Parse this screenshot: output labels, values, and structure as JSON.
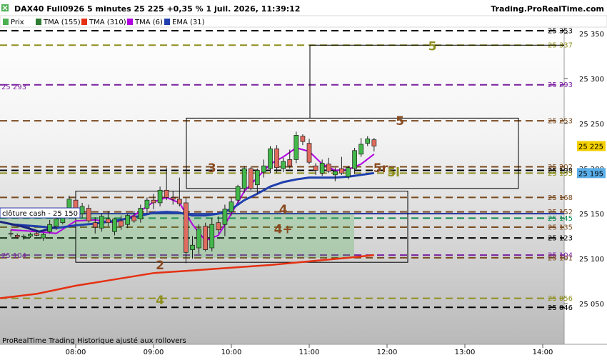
{
  "header": {
    "title": "DAX40 Full0926 5 minutes 25 225 +0,35 % 1 juil. 2026, 11:39:12",
    "site": "Trading.ProRealTime.com"
  },
  "legend": [
    {
      "label": "Prix",
      "color": "#4caf50"
    },
    {
      "label": "TMA (155)",
      "color": "#2e7d32"
    },
    {
      "label": "TMA (310)",
      "color": "#e53012"
    },
    {
      "label": "TMA (6)",
      "color": "#b000e0"
    },
    {
      "label": "EMA (31)",
      "color": "#1f3fae"
    }
  ],
  "footer": {
    "text": "ProRealTime Trading  Historique ajusté aux rollovers"
  },
  "annotations": {
    "cloture_label": "clôture cash - ",
    "cloture_value": "25 150",
    "left_price": "25 104",
    "left_price_purple": "25 293"
  },
  "chart_data": {
    "type": "candlestick",
    "instrument": "DAX40 Full0926",
    "timeframe": "5 minutes",
    "x_ticks": [
      "08:00",
      "09:00",
      "10:00",
      "11:00",
      "12:00",
      "13:00",
      "14:00"
    ],
    "y_ticks": [
      25050,
      25100,
      25150,
      25200,
      25250,
      25300,
      25350
    ],
    "y_tick_labels": [
      "25 050",
      "25 100",
      "25 150",
      "25 200",
      "25 250",
      "25 300",
      "25 350"
    ],
    "ylim": [
      25007,
      25360
    ],
    "current_price": "25 225",
    "ema_last": "25 195",
    "candles": [
      {
        "t": "07:10",
        "o": 25128,
        "h": 25132,
        "l": 25124,
        "c": 25128
      },
      {
        "t": "07:15",
        "o": 25126,
        "h": 25128,
        "l": 25122,
        "c": 25124
      },
      {
        "t": "07:20",
        "o": 25124,
        "h": 25127,
        "l": 25121,
        "c": 25125
      },
      {
        "t": "07:25",
        "o": 25125,
        "h": 25129,
        "l": 25123,
        "c": 25127
      },
      {
        "t": "07:30",
        "o": 25128,
        "h": 25130,
        "l": 25125,
        "c": 25126
      },
      {
        "t": "07:35",
        "o": 25123,
        "h": 25129,
        "l": 25120,
        "c": 25127
      },
      {
        "t": "07:40",
        "o": 25130,
        "h": 25143,
        "l": 25128,
        "c": 25138
      },
      {
        "t": "07:45",
        "o": 25136,
        "h": 25147,
        "l": 25132,
        "c": 25144
      },
      {
        "t": "07:50",
        "o": 25140,
        "h": 25153,
        "l": 25138,
        "c": 25150
      },
      {
        "t": "07:55",
        "o": 25150,
        "h": 25170,
        "l": 25147,
        "c": 25166
      },
      {
        "t": "08:00",
        "o": 25165,
        "h": 25168,
        "l": 25147,
        "c": 25150
      },
      {
        "t": "08:05",
        "o": 25150,
        "h": 25162,
        "l": 25145,
        "c": 25158
      },
      {
        "t": "08:10",
        "o": 25156,
        "h": 25160,
        "l": 25140,
        "c": 25142
      },
      {
        "t": "08:15",
        "o": 25140,
        "h": 25146,
        "l": 25128,
        "c": 25135
      },
      {
        "t": "08:20",
        "o": 25134,
        "h": 25150,
        "l": 25130,
        "c": 25147
      },
      {
        "t": "08:25",
        "o": 25144,
        "h": 25153,
        "l": 25136,
        "c": 25140
      },
      {
        "t": "08:30",
        "o": 25130,
        "h": 25145,
        "l": 25126,
        "c": 25144
      },
      {
        "t": "08:35",
        "o": 25142,
        "h": 25148,
        "l": 25132,
        "c": 25136
      },
      {
        "t": "08:40",
        "o": 25138,
        "h": 25150,
        "l": 25134,
        "c": 25148
      },
      {
        "t": "08:45",
        "o": 25147,
        "h": 25153,
        "l": 25140,
        "c": 25142
      },
      {
        "t": "08:50",
        "o": 25144,
        "h": 25160,
        "l": 25140,
        "c": 25156
      },
      {
        "t": "08:55",
        "o": 25156,
        "h": 25168,
        "l": 25150,
        "c": 25165
      },
      {
        "t": "09:00",
        "o": 25165,
        "h": 25172,
        "l": 25155,
        "c": 25162
      },
      {
        "t": "09:05",
        "o": 25162,
        "h": 25180,
        "l": 25158,
        "c": 25176
      },
      {
        "t": "09:10",
        "o": 25176,
        "h": 25201,
        "l": 25165,
        "c": 25168
      },
      {
        "t": "09:15",
        "o": 25168,
        "h": 25175,
        "l": 25160,
        "c": 25166
      },
      {
        "t": "09:20",
        "o": 25166,
        "h": 25190,
        "l": 25158,
        "c": 25161
      },
      {
        "t": "09:25",
        "o": 25162,
        "h": 25168,
        "l": 25095,
        "c": 25107
      },
      {
        "t": "09:30",
        "o": 25110,
        "h": 25125,
        "l": 25100,
        "c": 25115
      },
      {
        "t": "09:35",
        "o": 25112,
        "h": 25138,
        "l": 25105,
        "c": 25133
      },
      {
        "t": "09:40",
        "o": 25136,
        "h": 25140,
        "l": 25108,
        "c": 25110
      },
      {
        "t": "09:45",
        "o": 25112,
        "h": 25145,
        "l": 25108,
        "c": 25138
      },
      {
        "t": "09:50",
        "o": 25140,
        "h": 25147,
        "l": 25128,
        "c": 25132
      },
      {
        "t": "09:55",
        "o": 25138,
        "h": 25160,
        "l": 25125,
        "c": 25155
      },
      {
        "t": "10:00",
        "o": 25152,
        "h": 25168,
        "l": 25148,
        "c": 25163
      },
      {
        "t": "10:05",
        "o": 25165,
        "h": 25182,
        "l": 25162,
        "c": 25180
      },
      {
        "t": "10:10",
        "o": 25178,
        "h": 25203,
        "l": 25173,
        "c": 25200
      },
      {
        "t": "10:15",
        "o": 25200,
        "h": 25202,
        "l": 25176,
        "c": 25178
      },
      {
        "t": "10:20",
        "o": 25182,
        "h": 25200,
        "l": 25172,
        "c": 25198
      },
      {
        "t": "10:25",
        "o": 25196,
        "h": 25210,
        "l": 25190,
        "c": 25203
      },
      {
        "t": "10:30",
        "o": 25200,
        "h": 25225,
        "l": 25195,
        "c": 25222
      },
      {
        "t": "10:35",
        "o": 25222,
        "h": 25226,
        "l": 25195,
        "c": 25201
      },
      {
        "t": "10:40",
        "o": 25200,
        "h": 25212,
        "l": 25196,
        "c": 25208
      },
      {
        "t": "10:45",
        "o": 25210,
        "h": 25221,
        "l": 25200,
        "c": 25203
      },
      {
        "t": "10:50",
        "o": 25210,
        "h": 25241,
        "l": 25206,
        "c": 25237
      },
      {
        "t": "10:55",
        "o": 25236,
        "h": 25238,
        "l": 25226,
        "c": 25230
      },
      {
        "t": "11:00",
        "o": 25228,
        "h": 25233,
        "l": 25205,
        "c": 25207
      },
      {
        "t": "11:05",
        "o": 25203,
        "h": 25206,
        "l": 25193,
        "c": 25198
      },
      {
        "t": "11:10",
        "o": 25195,
        "h": 25210,
        "l": 25192,
        "c": 25206
      },
      {
        "t": "11:15",
        "o": 25205,
        "h": 25212,
        "l": 25195,
        "c": 25197
      },
      {
        "t": "11:20",
        "o": 25193,
        "h": 25201,
        "l": 25186,
        "c": 25197
      },
      {
        "t": "11:25",
        "o": 25200,
        "h": 25213,
        "l": 25193,
        "c": 25195
      },
      {
        "t": "11:30",
        "o": 25191,
        "h": 25203,
        "l": 25188,
        "c": 25201
      },
      {
        "t": "11:35",
        "o": 25200,
        "h": 25223,
        "l": 25194,
        "c": 25220
      },
      {
        "t": "11:40",
        "o": 25216,
        "h": 25234,
        "l": 25213,
        "c": 25227
      },
      {
        "t": "11:45",
        "o": 25228,
        "h": 25236,
        "l": 25225,
        "c": 25233
      },
      {
        "t": "11:50",
        "o": 25232,
        "h": 25234,
        "l": 25219,
        "c": 25225
      }
    ],
    "series": [
      {
        "name": "TMA (6)",
        "color": "#b000e0",
        "points": [
          [
            "07:10",
            25132
          ],
          [
            "07:30",
            25130
          ],
          [
            "07:45",
            25128
          ],
          [
            "08:00",
            25142
          ],
          [
            "08:15",
            25143
          ],
          [
            "08:30",
            25140
          ],
          [
            "08:45",
            25148
          ],
          [
            "09:00",
            25163
          ],
          [
            "09:10",
            25168
          ],
          [
            "09:20",
            25162
          ],
          [
            "09:30",
            25138
          ],
          [
            "09:40",
            25120
          ],
          [
            "09:50",
            25126
          ],
          [
            "10:00",
            25150
          ],
          [
            "10:10",
            25175
          ],
          [
            "10:20",
            25190
          ],
          [
            "10:30",
            25205
          ],
          [
            "10:40",
            25213
          ],
          [
            "10:50",
            25223
          ],
          [
            "11:00",
            25219
          ],
          [
            "11:10",
            25205
          ],
          [
            "11:20",
            25198
          ],
          [
            "11:30",
            25199
          ],
          [
            "11:40",
            25205
          ],
          [
            "11:50",
            25216
          ]
        ]
      },
      {
        "name": "EMA (31)",
        "color": "#1f3fae",
        "points": [
          [
            "07:10",
            25138
          ],
          [
            "07:30",
            25136
          ],
          [
            "07:45",
            25134
          ],
          [
            "08:00",
            25137
          ],
          [
            "08:15",
            25139
          ],
          [
            "08:30",
            25142
          ],
          [
            "08:45",
            25146
          ],
          [
            "09:00",
            25151
          ],
          [
            "09:10",
            25152
          ],
          [
            "09:20",
            25151
          ],
          [
            "09:30",
            25148
          ],
          [
            "09:40",
            25148
          ],
          [
            "09:50",
            25150
          ],
          [
            "10:00",
            25155
          ],
          [
            "10:10",
            25165
          ],
          [
            "10:20",
            25172
          ],
          [
            "10:30",
            25180
          ],
          [
            "10:40",
            25185
          ],
          [
            "10:50",
            25188
          ],
          [
            "11:00",
            25190
          ],
          [
            "11:10",
            25190
          ],
          [
            "11:20",
            25190
          ],
          [
            "11:30",
            25191
          ],
          [
            "11:40",
            25193
          ],
          [
            "11:50",
            25195
          ]
        ]
      },
      {
        "name": "TMA (310)",
        "color": "#e53012",
        "points": [
          [
            "06:55",
            25055
          ],
          [
            "07:30",
            25061
          ],
          [
            "08:00",
            25070
          ],
          [
            "08:30",
            25077
          ],
          [
            "09:00",
            25084
          ],
          [
            "09:30",
            25087
          ],
          [
            "10:00",
            25090
          ],
          [
            "10:30",
            25093
          ],
          [
            "11:00",
            25097
          ],
          [
            "11:30",
            25101
          ],
          [
            "11:50",
            25104
          ]
        ]
      }
    ],
    "levels": [
      {
        "value": 25353,
        "label": "25 353",
        "color": "#000000",
        "style": "dash"
      },
      {
        "value": 25337,
        "label": "25 337",
        "color": "#8f8f1f",
        "style": "dash"
      },
      {
        "value": 25293,
        "label": "25 293",
        "color": "#7a1fa0",
        "style": "dash"
      },
      {
        "value": 25253,
        "label": "25 253",
        "color": "#7a4a1f",
        "style": "dash"
      },
      {
        "value": 25202,
        "label": "25 202",
        "color": "#7a4a1f",
        "style": "dash"
      },
      {
        "value": 25198,
        "label": "25 198",
        "color": "#000000",
        "style": "dash"
      },
      {
        "value": 25195,
        "label": "25 195",
        "color": "#8f8f1f",
        "style": "dash"
      },
      {
        "value": 25168,
        "label": "25 168",
        "color": "#7a4a1f",
        "style": "dash"
      },
      {
        "value": 25152,
        "label": "25 152",
        "color": "#7a4a1f",
        "style": "dash"
      },
      {
        "value": 25145,
        "label": "25 145",
        "color": "#0a8a50",
        "style": "dash"
      },
      {
        "value": 25135,
        "label": "25 135",
        "color": "#7a4a1f",
        "style": "dash"
      },
      {
        "value": 25123,
        "label": "25 123",
        "color": "#000000",
        "style": "dash"
      },
      {
        "value": 25104,
        "label": "25 104",
        "color": "#7a1fa0",
        "style": "dash"
      },
      {
        "value": 25101,
        "label": "25 101",
        "color": "#7a4a1f",
        "style": "dash"
      },
      {
        "value": 25056,
        "label": "25 056",
        "color": "#8f8f1f",
        "style": "dash"
      },
      {
        "value": 25046,
        "label": "25 046",
        "color": "#000000",
        "style": "dash"
      }
    ],
    "cloture_cash": 25150,
    "wave_labels": [
      {
        "text": "5",
        "t": "12:35",
        "v": 25336,
        "color": "#8f8f1f"
      },
      {
        "text": "5",
        "t": "12:10",
        "v": 25253,
        "color": "#8a4a1f"
      },
      {
        "text": "3",
        "t": "09:45",
        "v": 25201,
        "color": "#8a4a1f"
      },
      {
        "text": "5r",
        "t": "11:55",
        "v": 25201,
        "color": "#8a4a1f"
      },
      {
        "text": "5l",
        "t": "12:05",
        "v": 25196,
        "color": "#8f8f1f"
      },
      {
        "text": "4",
        "t": "10:40",
        "v": 25155,
        "color": "#8a4a1f"
      },
      {
        "text": "4+",
        "t": "10:40",
        "v": 25133,
        "color": "#8a4a1f"
      },
      {
        "text": "2",
        "t": "09:05",
        "v": 25093,
        "color": "#8a4a1f"
      },
      {
        "text": "4",
        "t": "09:05",
        "v": 25054,
        "color": "#8f8f1f"
      }
    ],
    "price_tags": [
      {
        "value": 25225,
        "label": "25 225",
        "bg": "#f3d000",
        "fg": "#000000"
      },
      {
        "value": 25195,
        "label": "25 195",
        "bg": "#5aaee8",
        "fg": "#000000"
      }
    ],
    "grid": false
  }
}
